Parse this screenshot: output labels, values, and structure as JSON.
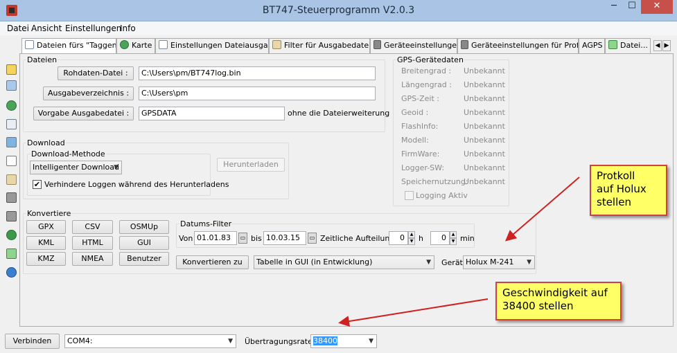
{
  "window": {
    "title": "BT747-Steuerprogramm V2.0.3",
    "min_glyph": "─",
    "max_glyph": "☐",
    "close_glyph": "✕"
  },
  "menu": [
    "Datei",
    "Ansicht",
    "Einstellungen",
    "Info"
  ],
  "tabs": [
    {
      "label": "Dateien fürs \"Taggen\"",
      "icon": "file-tag-icon"
    },
    {
      "label": "Karte",
      "icon": "globe-icon"
    },
    {
      "label": "Einstellungen Dateiausgabe",
      "icon": "document-icon"
    },
    {
      "label": "Filter für Ausgabedaten",
      "icon": "hourglass-icon"
    },
    {
      "label": "Geräteeinstellungen",
      "icon": "wrench-icon"
    },
    {
      "label": "Geräteeinstellungen für Profis",
      "icon": "wrench-plus-icon"
    },
    {
      "label": "AGPS",
      "icon": ""
    },
    {
      "label": "Datei...",
      "icon": "export-icon"
    }
  ],
  "tab_nav": {
    "prev": "◀",
    "next": "▶"
  },
  "sidebar_icons": [
    "home-icon",
    "windows-icon",
    "globe-icon",
    "list-icon",
    "filter-icon",
    "document-icon",
    "hourglass-icon",
    "wrench-icon",
    "wrench-plus-icon",
    "earth-icon",
    "export-icon",
    "info-icon"
  ],
  "dateien": {
    "title": "Dateien",
    "rohdaten_button": "Rohdaten-Datei :",
    "rohdaten_value": "C:\\Users\\pm/BT747log.bin",
    "ausgabeverz_button": "Ausgabeverzeichnis :",
    "ausgabeverz_value": "C:\\Users\\pm",
    "vorgabe_button": "Vorgabe Ausgabedatei :",
    "vorgabe_value": "GPSDATA",
    "vorgabe_suffix": "ohne die Dateierweiterung"
  },
  "gps": {
    "title": "GPS-Gerätedaten",
    "rows": [
      {
        "label": "Breitengrad :",
        "value": "Unbekannt"
      },
      {
        "label": "Längengrad :",
        "value": "Unbekannt"
      },
      {
        "label": "GPS-Zeit :",
        "value": "Unbekannt"
      },
      {
        "label": "Geoid :",
        "value": "Unbekannt"
      },
      {
        "label": "FlashInfo:",
        "value": "Unbekannt"
      },
      {
        "label": "Modell:",
        "value": "Unbekannt"
      },
      {
        "label": "FirmWare:",
        "value": "Unbekannt"
      },
      {
        "label": "Logger-SW:",
        "value": "Unbekannt"
      },
      {
        "label": "Speichernutzung:",
        "value": "Unbekannt"
      }
    ],
    "logging_label": "Logging Aktiv"
  },
  "download": {
    "title": "Download",
    "method_title": "Download-Methode",
    "method_value": "Intelligenter Download",
    "checkbox_label": "Verhindere Loggen während des Herunterladens",
    "checkbox_mark": "✔",
    "button": "Herunterladen"
  },
  "konvertiere": {
    "title": "Konvertiere",
    "formats": [
      "GPX",
      "CSV",
      "OSMUp",
      "KML",
      "HTML",
      "GUI",
      "KMZ",
      "NMEA",
      "Benutzer"
    ],
    "datum_title": "Datums-Filter",
    "von_label": "Von",
    "von_value": "01.01.83",
    "bis_label": "bis",
    "bis_value": "10.03.15",
    "zeitliche_label": "Zeitliche Aufteilung:",
    "hours_value": "0",
    "hours_unit": "h",
    "min_value": "0",
    "min_unit": "min",
    "convert_button": "Konvertieren zu",
    "target_value": "Tabelle in GUI (in Entwicklung)",
    "geraet_label": "Gerät",
    "geraet_value": "Holux M-241"
  },
  "status": {
    "connect_button": "Verbinden",
    "port_value": "COM4:",
    "rate_label": "Übertragungsrate:",
    "rate_value": "38400"
  },
  "callouts": {
    "protokoll": [
      "Protkoll",
      "auf Holux",
      "stellen"
    ],
    "speed": [
      "Geschwindigkeit auf",
      "38400 stellen"
    ]
  },
  "colors": {
    "titlebar": "#a9c4e4",
    "close": "#c7504a",
    "callout_bg": "#ffff66",
    "callout_border": "#d04040",
    "arrow": "#d02020",
    "selection": "#3399ff"
  }
}
